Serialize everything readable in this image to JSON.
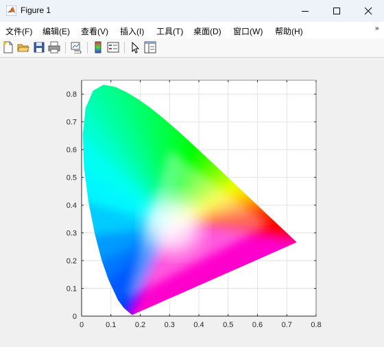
{
  "window": {
    "title": "Figure 1",
    "icon": "matlab-logo-icon",
    "controls": [
      "minimize-icon",
      "maximize-icon",
      "close-icon"
    ]
  },
  "menu": {
    "items": [
      {
        "label": "文件(F)"
      },
      {
        "label": "编辑(E)"
      },
      {
        "label": "查看(V)"
      },
      {
        "label": "插入(I)"
      },
      {
        "label": "工具(T)"
      },
      {
        "label": "桌面(D)"
      },
      {
        "label": "窗口(W)"
      },
      {
        "label": "帮助(H)"
      }
    ],
    "overflow_icon": "chevron-double-icon"
  },
  "toolbar": {
    "buttons": [
      "new-figure-icon",
      "open-file-icon",
      "save-icon",
      "print-icon",
      "link-plot-icon",
      "colorbar-icon",
      "legend-icon",
      "select-arrow-icon",
      "property-inspector-icon"
    ]
  },
  "chart_data": {
    "type": "area",
    "description_visible": "CIE 1931 chromaticity diagram filled with colors, sRGB triangle brighter inside",
    "xlim": [
      0,
      0.8
    ],
    "ylim": [
      0,
      0.85
    ],
    "xticks": [
      "0",
      "0.1",
      "0.2",
      "0.3",
      "0.4",
      "0.5",
      "0.6",
      "0.7",
      "0.8"
    ],
    "yticks": [
      "0",
      "0.1",
      "0.2",
      "0.3",
      "0.4",
      "0.5",
      "0.6",
      "0.7",
      "0.8"
    ],
    "grid": true,
    "spectral_locus": {
      "x": [
        0.1741,
        0.1738,
        0.1733,
        0.1726,
        0.1714,
        0.1689,
        0.1644,
        0.1566,
        0.144,
        0.1241,
        0.0913,
        0.0687,
        0.0454,
        0.0235,
        0.0082,
        0.0039,
        0.0139,
        0.0389,
        0.0743,
        0.1142,
        0.1547,
        0.1929,
        0.2296,
        0.2658,
        0.3016,
        0.3373,
        0.3731,
        0.4087,
        0.4441,
        0.4788,
        0.5125,
        0.5448,
        0.5752,
        0.6029,
        0.627,
        0.6482,
        0.6658,
        0.6801,
        0.6915,
        0.7006,
        0.7079,
        0.714,
        0.719,
        0.723,
        0.726,
        0.7283,
        0.73,
        0.7311,
        0.732,
        0.7327,
        0.7334,
        0.734
      ],
      "y": [
        0.005,
        0.0049,
        0.0048,
        0.0048,
        0.0051,
        0.0069,
        0.0109,
        0.0177,
        0.0297,
        0.0578,
        0.1327,
        0.2007,
        0.295,
        0.4127,
        0.5384,
        0.6548,
        0.7502,
        0.812,
        0.8338,
        0.8262,
        0.8059,
        0.7816,
        0.7543,
        0.7243,
        0.6923,
        0.6589,
        0.6245,
        0.5896,
        0.5547,
        0.5202,
        0.4866,
        0.4544,
        0.4242,
        0.3965,
        0.3725,
        0.3514,
        0.334,
        0.3197,
        0.3083,
        0.2993,
        0.292,
        0.2859,
        0.2809,
        0.277,
        0.274,
        0.2717,
        0.27,
        0.2689,
        0.268,
        0.2673,
        0.2666,
        0.266
      ]
    },
    "gamut_triangle": {
      "x": [
        0.64,
        0.3,
        0.15
      ],
      "y": [
        0.33,
        0.6,
        0.06
      ],
      "white_point": [
        0.3127,
        0.329
      ]
    }
  }
}
